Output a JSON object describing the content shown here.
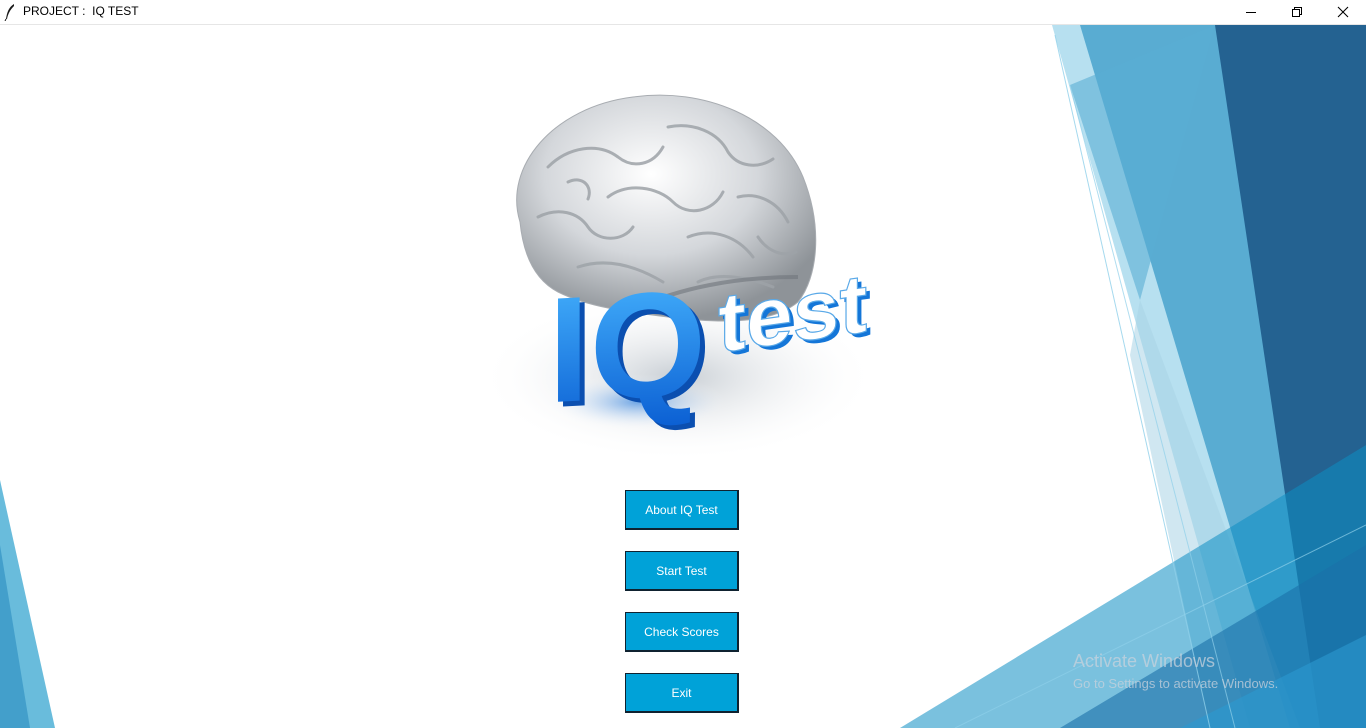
{
  "window": {
    "title": "PROJECT :  IQ TEST"
  },
  "title_controls": {
    "minimize_icon": "minimize-icon",
    "restore_icon": "restore-icon",
    "close_icon": "close-icon"
  },
  "logo": {
    "brand_text_iq": "IQ",
    "brand_text_test": "test"
  },
  "menu": {
    "about_label": "About IQ Test",
    "start_label": "Start Test",
    "scores_label": "Check Scores",
    "exit_label": "Exit"
  },
  "watermark": {
    "line1": "Activate Windows",
    "line2": "Go to Settings to activate Windows."
  },
  "colors": {
    "button_bg": "#00a2d8",
    "accent_dark": "#1e5a8a",
    "accent_mid": "#2d8fbe",
    "accent_light": "#7cc6e3"
  }
}
